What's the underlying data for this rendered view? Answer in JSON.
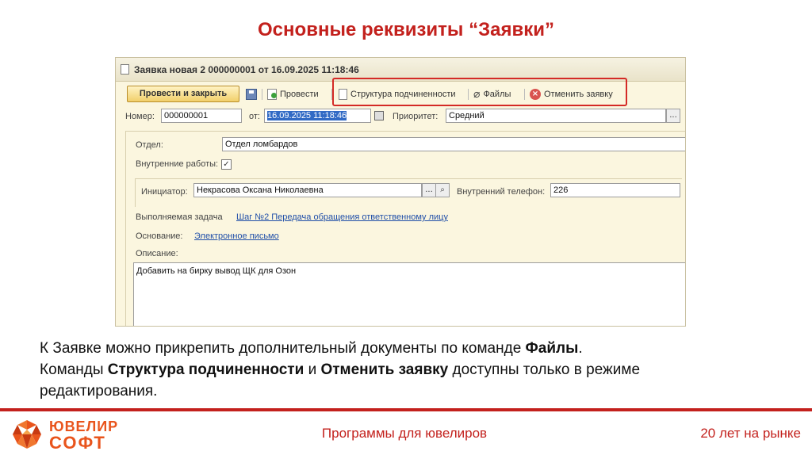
{
  "slide": {
    "title": "Основные реквизиты “Заявки”"
  },
  "window": {
    "title": "Заявка новая 2 000000001 от 16.09.2025 11:18:46",
    "toolbar": {
      "post_close": "Провести и закрыть",
      "post": "Провести",
      "structure": "Структура подчиненности",
      "files": "Файлы",
      "cancel": "Отменить заявку"
    },
    "fields": {
      "number_label": "Номер:",
      "number_value": "000000001",
      "date_label": "от:",
      "date_value": "16.09.2025 11:18:46",
      "priority_label": "Приоритет:",
      "priority_value": "Средний",
      "dept_label": "Отдел:",
      "dept_value": "Отдел ломбардов",
      "internal_label": "Внутренние работы:",
      "internal_checked": true,
      "initiator_label": "Инициатор:",
      "initiator_value": "Некрасова Оксана Николаевна",
      "phone_label": "Внутренний телефон:",
      "phone_value": "226",
      "task_label": "Выполняемая задача",
      "task_link": "Шаг №2 Передача обращения ответственному лицу",
      "basis_label": "Основание:",
      "basis_link": "Электронное письмо",
      "desc_label": "Описание:",
      "desc_value": "Добавить на бирку вывод ЩК для Озон"
    }
  },
  "caption": {
    "line1_pre": "К Заявке можно прикрепить дополнительный документы по команде ",
    "line1_bold": "Файлы",
    "line1_post": ".",
    "line2_pre": "Команды ",
    "line2_bold1": "Структура подчиненности",
    "line2_mid": " и ",
    "line2_bold2": "Отменить заявку",
    "line2_post": " доступны только в режиме",
    "line3": "редактирования."
  },
  "footer": {
    "logo_line1": "ЮВЕЛИР",
    "logo_line2": "СОФТ",
    "center": "Программы для ювелиров",
    "right": "20 лет на рынке"
  },
  "colors": {
    "accent": "#c3211d",
    "logo": "#e9541c",
    "link": "#1f4ea8"
  }
}
